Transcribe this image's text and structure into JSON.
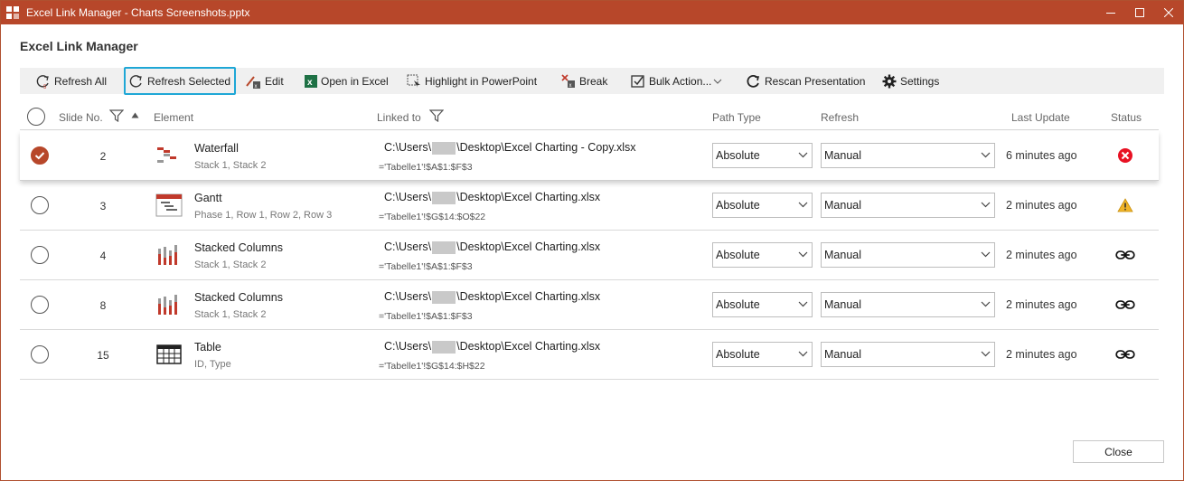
{
  "window": {
    "title": "Excel Link Manager - Charts Screenshots.pptx",
    "accent_color": "#b7472a"
  },
  "heading": "Excel Link Manager",
  "toolbar": {
    "refresh_all": "Refresh All",
    "refresh_selected": "Refresh Selected",
    "edit": "Edit",
    "open_in_excel": "Open in Excel",
    "highlight": "Highlight in PowerPoint",
    "break": "Break",
    "bulk_action": "Bulk Action...",
    "rescan": "Rescan Presentation",
    "settings": "Settings"
  },
  "columns": {
    "slide_no": "Slide No.",
    "element": "Element",
    "linked_to": "Linked to",
    "path_type": "Path Type",
    "refresh": "Refresh",
    "last_update": "Last Update",
    "status": "Status"
  },
  "rows": [
    {
      "selected": true,
      "slide": "2",
      "icon": "waterfall-chart-icon",
      "name": "Waterfall",
      "sub": "Stack 1, Stack 2",
      "path_prefix": "C:\\Users\\",
      "path_suffix": "\\Desktop\\Excel Charting - Copy.xlsx",
      "ref": "='Tabelle1'!$A$1:$F$3",
      "path_type": "Absolute",
      "refresh": "Manual",
      "last_update": "6 minutes ago",
      "status": "error-icon"
    },
    {
      "selected": false,
      "slide": "3",
      "icon": "gantt-chart-icon",
      "name": "Gantt",
      "sub": "Phase 1, Row 1, Row 2, Row 3",
      "path_prefix": "C:\\Users\\",
      "path_suffix": "\\Desktop\\Excel Charting.xlsx",
      "ref": "='Tabelle1'!$G$14:$O$22",
      "path_type": "Absolute",
      "refresh": "Manual",
      "last_update": "2 minutes ago",
      "status": "warning-icon"
    },
    {
      "selected": false,
      "slide": "4",
      "icon": "stacked-columns-icon",
      "name": "Stacked Columns",
      "sub": "Stack 1, Stack 2",
      "path_prefix": "C:\\Users\\",
      "path_suffix": "\\Desktop\\Excel Charting.xlsx",
      "ref": "='Tabelle1'!$A$1:$F$3",
      "path_type": "Absolute",
      "refresh": "Manual",
      "last_update": "2 minutes ago",
      "status": "link-icon"
    },
    {
      "selected": false,
      "slide": "8",
      "icon": "stacked-columns-icon",
      "name": "Stacked Columns",
      "sub": "Stack 1, Stack 2",
      "path_prefix": "C:\\Users\\",
      "path_suffix": "\\Desktop\\Excel Charting.xlsx",
      "ref": "='Tabelle1'!$A$1:$F$3",
      "path_type": "Absolute",
      "refresh": "Manual",
      "last_update": "2 minutes ago",
      "status": "link-icon"
    },
    {
      "selected": false,
      "slide": "15",
      "icon": "table-icon",
      "name": "Table",
      "sub": "ID, Type",
      "path_prefix": "C:\\Users\\",
      "path_suffix": "\\Desktop\\Excel Charting.xlsx",
      "ref": "='Tabelle1'!$G$14:$H$22",
      "path_type": "Absolute",
      "refresh": "Manual",
      "last_update": "2 minutes ago",
      "status": "link-icon"
    }
  ],
  "close_label": "Close"
}
